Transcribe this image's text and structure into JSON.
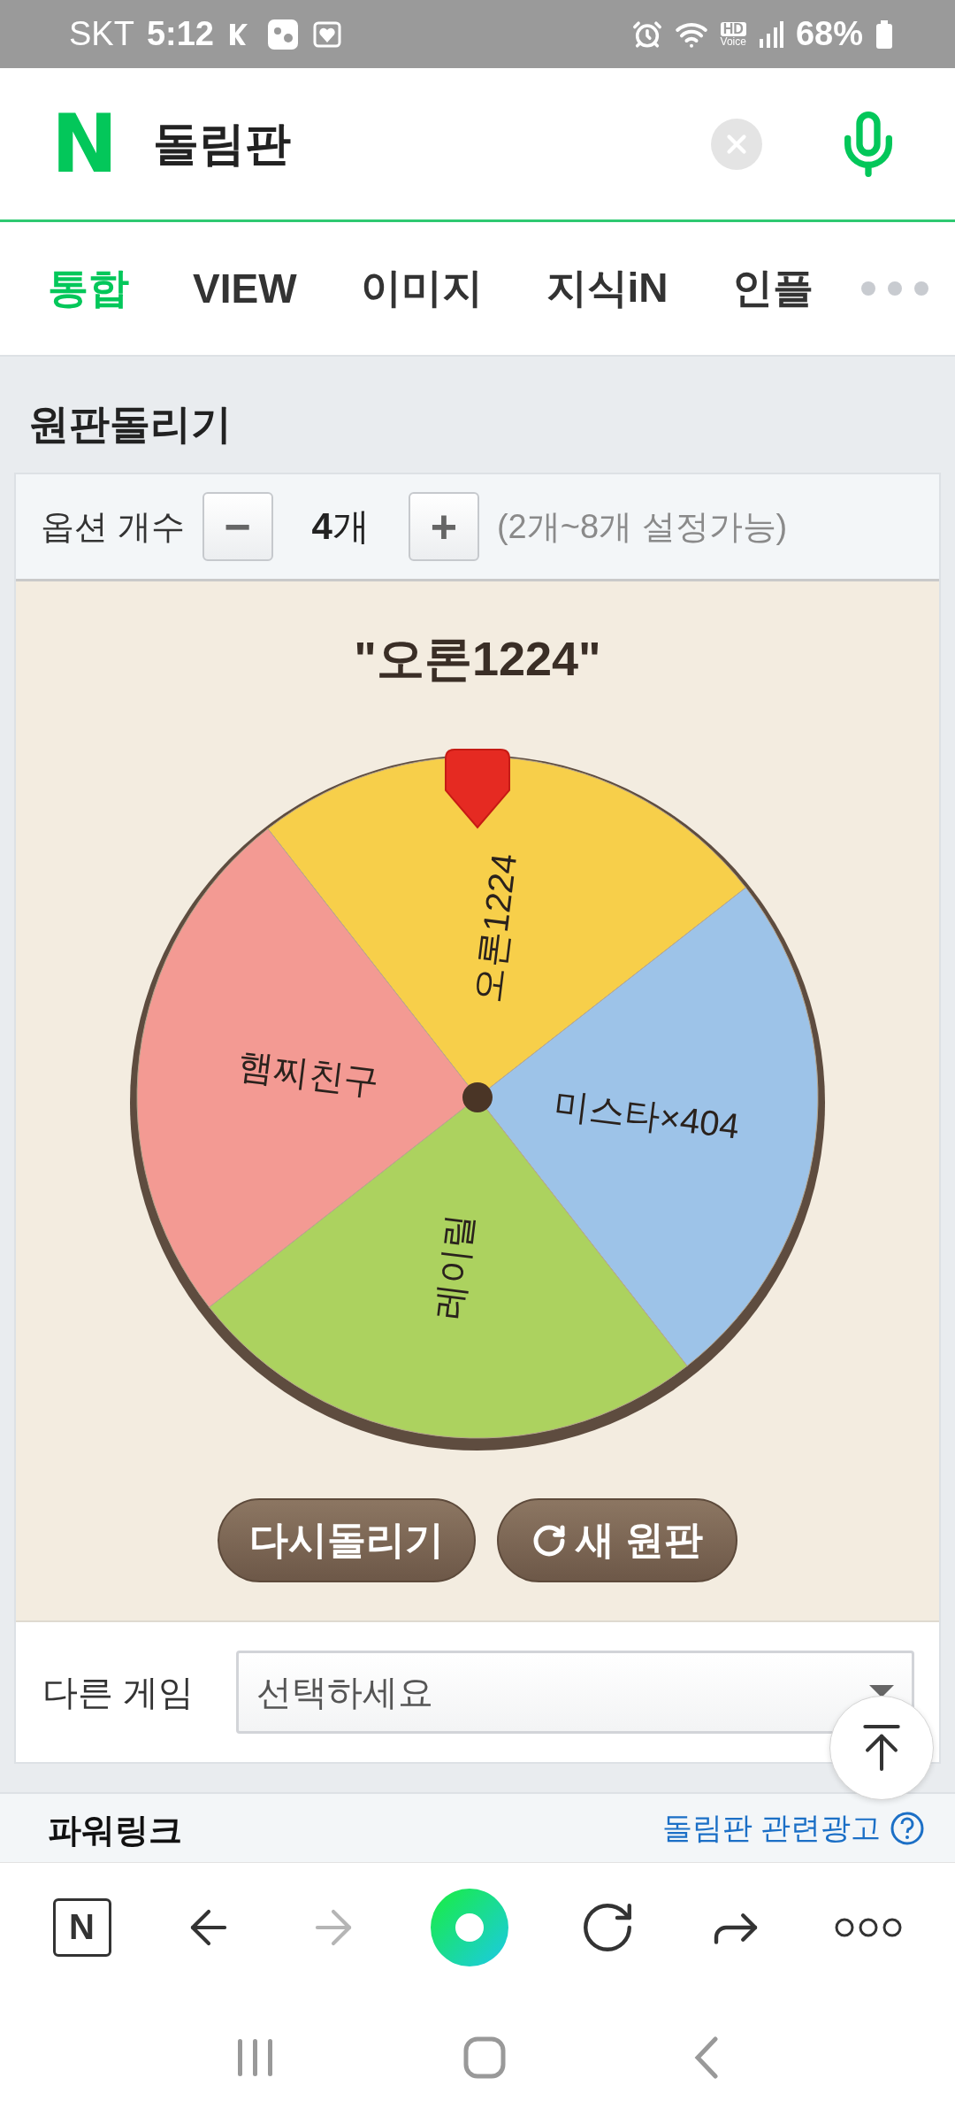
{
  "status_bar": {
    "carrier": "SKT",
    "time": "5:12",
    "hd_label": "HD",
    "voice_label": "Voice",
    "battery": "68%"
  },
  "search": {
    "logo": "N",
    "query": "돌림판"
  },
  "tabs": [
    {
      "label": "통합",
      "selected": true
    },
    {
      "label": "VIEW",
      "selected": false
    },
    {
      "label": "이미지",
      "selected": false
    },
    {
      "label": "지식iN",
      "selected": false
    },
    {
      "label": "인플",
      "selected": false
    }
  ],
  "section_title": "원판돌리기",
  "option_count": {
    "label": "옵션 개수",
    "minus": "−",
    "value": "**4**개",
    "plus": "+",
    "hint": "(2개~8개 설정가능)"
  },
  "wheel": {
    "result": "\"오론1224\"",
    "slices": [
      {
        "label": "오론1224",
        "color": "#f7cf4a"
      },
      {
        "label": "미스타×404",
        "color": "#9dc3e8"
      },
      {
        "label": "레이릴",
        "color": "#acd25f"
      },
      {
        "label": "햄찌친구",
        "color": "#f39a93"
      }
    ]
  },
  "buttons": [
    {
      "kind": "spin",
      "label": "다시돌리기"
    },
    {
      "kind": "reset",
      "label": "새 원판"
    }
  ],
  "other_game": {
    "label": "다른 게임",
    "value": "선택하세요"
  },
  "powerlink": {
    "title": "파워링크",
    "ad_link": "돌림판 관련광고"
  },
  "browser_toolbar": {
    "home_label": "N",
    "forward_disabled": true
  }
}
